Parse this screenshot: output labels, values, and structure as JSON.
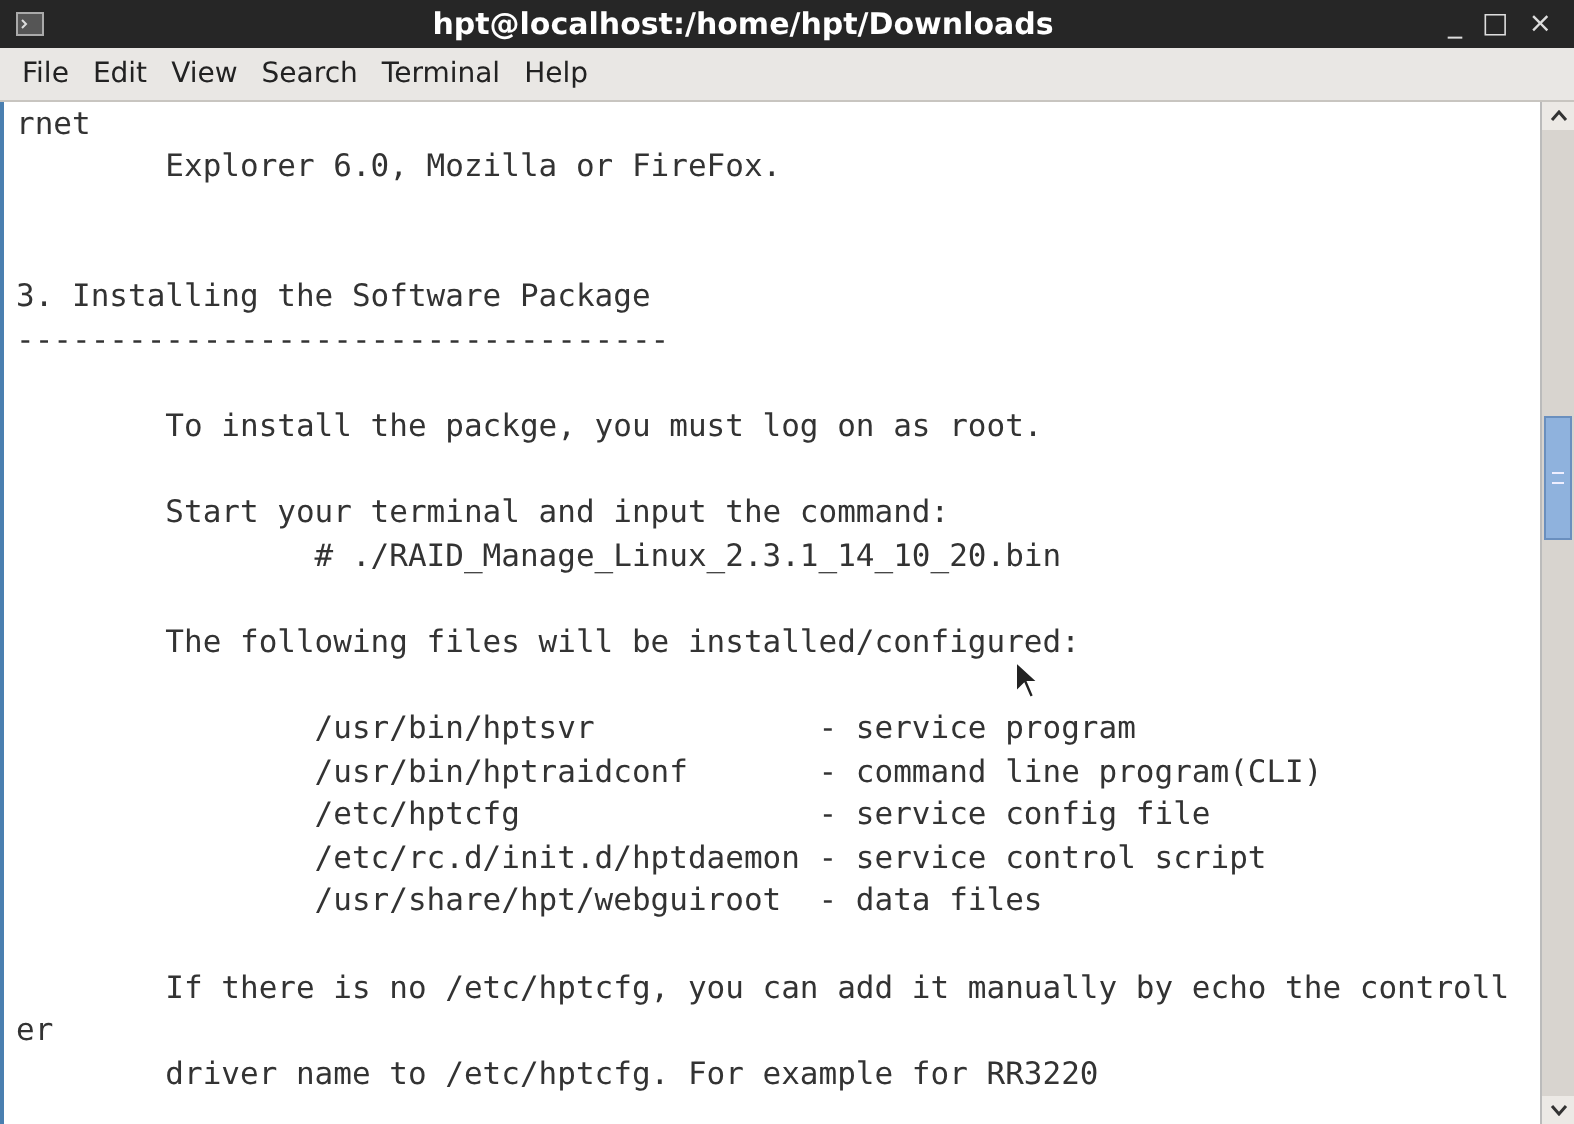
{
  "window": {
    "title": "hpt@localhost:/home/hpt/Downloads",
    "controls": [
      "_",
      "□",
      "×"
    ]
  },
  "menu": [
    "File",
    "Edit",
    "View",
    "Search",
    "Terminal",
    "Help"
  ],
  "terminal": {
    "lines": [
      {
        "kind": "text",
        "text": "rnet"
      },
      {
        "kind": "text",
        "text": "        Explorer 6.0, Mozilla or FireFox."
      },
      {
        "kind": "blank"
      },
      {
        "kind": "blank"
      },
      {
        "kind": "text",
        "text": "3. Installing the Software Package"
      },
      {
        "kind": "text",
        "text": "-----------------------------------"
      },
      {
        "kind": "blank"
      },
      {
        "kind": "text",
        "text": "        To install the packge, you must log on as root."
      },
      {
        "kind": "blank"
      },
      {
        "kind": "text",
        "text": "        Start your terminal and input the command:"
      },
      {
        "kind": "text",
        "text": "                # ./RAID_Manage_Linux_2.3.1_14_10_20.bin"
      },
      {
        "kind": "blank"
      },
      {
        "kind": "text",
        "text": "        The following files will be installed/configured:"
      },
      {
        "kind": "blank"
      },
      {
        "kind": "text",
        "text": "                /usr/bin/hptsvr            - service program"
      },
      {
        "kind": "text",
        "text": "                /usr/bin/hptraidconf       - command line program(CLI)"
      },
      {
        "kind": "text",
        "text": "                /etc/hptcfg                - service config file"
      },
      {
        "kind": "text",
        "text": "                /etc/rc.d/init.d/hptdaemon - service control script"
      },
      {
        "kind": "text",
        "text": "                /usr/share/hpt/webguiroot  - data files"
      },
      {
        "kind": "blank"
      },
      {
        "kind": "text",
        "text": "        If there is no /etc/hptcfg, you can add it manually by echo the controll"
      },
      {
        "kind": "text",
        "text": "er"
      },
      {
        "kind": "text",
        "text": "        driver name to /etc/hptcfg. For example for RR3220"
      }
    ]
  }
}
